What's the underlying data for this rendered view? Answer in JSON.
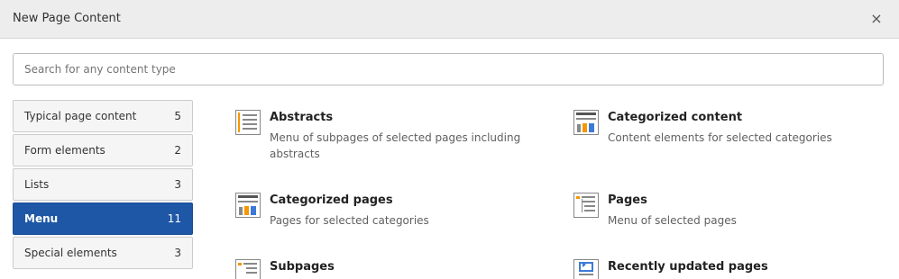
{
  "modal": {
    "title": "New Page Content",
    "close_symbol": "×"
  },
  "search": {
    "placeholder": "Search for any content type",
    "value": ""
  },
  "categories": [
    {
      "label": "Typical page content",
      "count": "5",
      "active": false
    },
    {
      "label": "Form elements",
      "count": "2",
      "active": false
    },
    {
      "label": "Lists",
      "count": "3",
      "active": false
    },
    {
      "label": "Menu",
      "count": "11",
      "active": true
    },
    {
      "label": "Special elements",
      "count": "3",
      "active": false
    }
  ],
  "items": [
    {
      "title": "Abstracts",
      "description": "Menu of subpages of selected pages including abstracts",
      "icon": "menu-abstract-icon"
    },
    {
      "title": "Categorized content",
      "description": "Content elements for selected categories",
      "icon": "menu-categorized-content-icon"
    },
    {
      "title": "Categorized pages",
      "description": "Pages for selected categories",
      "icon": "menu-categorized-pages-icon"
    },
    {
      "title": "Pages",
      "description": "Menu of selected pages",
      "icon": "menu-pages-icon"
    },
    {
      "title": "Subpages",
      "description": "",
      "icon": "menu-subpages-icon"
    },
    {
      "title": "Recently updated pages",
      "description": "",
      "icon": "menu-recently-updated-icon"
    }
  ],
  "colors": {
    "active_category": "#1e57a6",
    "icon_orange": "#f49700",
    "icon_blue": "#3d7ad6",
    "icon_gray": "#888888"
  }
}
